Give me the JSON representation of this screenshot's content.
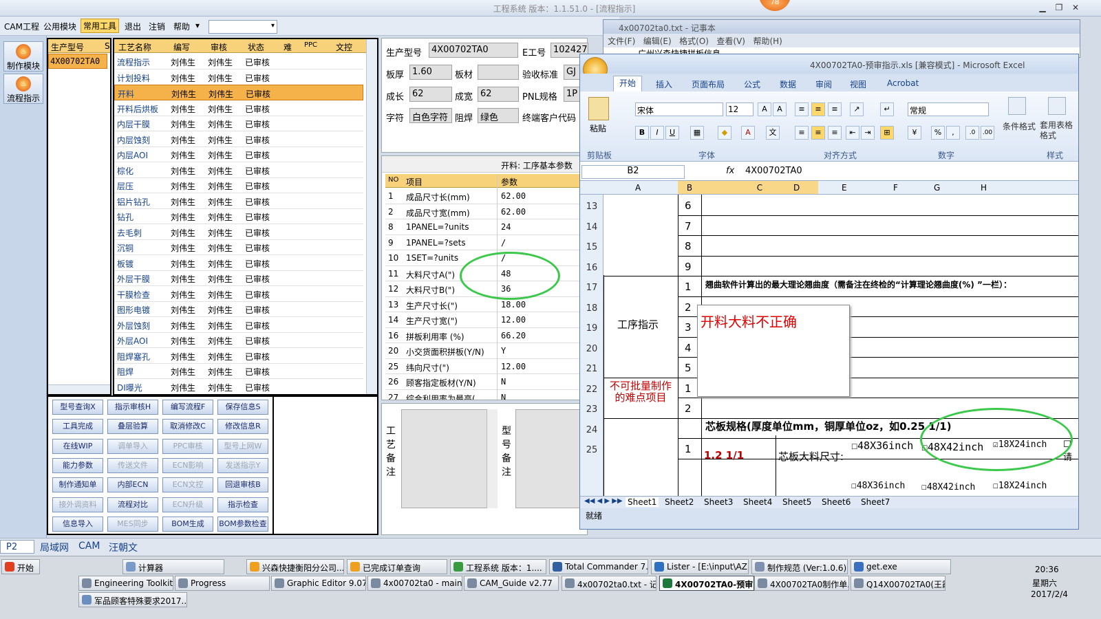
{
  "app": {
    "title": "工程系统  版本：1.1.51.0 - [流程指示]",
    "badge": "78",
    "win_min": "▁",
    "win_max": "❐",
    "win_close": "✕"
  },
  "menu": {
    "items": [
      "CAM工程",
      "公用模块",
      "常用工具",
      "退出",
      "注销",
      "帮助"
    ],
    "help_arrow": "▾",
    "combo_arrow": "▾"
  },
  "left_nav": {
    "make_module": "制作模块",
    "flow_indicator": "流程指示"
  },
  "model_list": {
    "header": "生产型号",
    "header2": "S",
    "item": "4X00702TA0"
  },
  "process_table": {
    "headers": [
      "工艺名称",
      "编写",
      "审核",
      "状态",
      "难",
      "PPC",
      "文控"
    ],
    "rows": [
      [
        "流程指示",
        "刘伟生",
        "刘伟生",
        "已审核"
      ],
      [
        "计划投料",
        "刘伟生",
        "刘伟生",
        "已审核"
      ],
      [
        "开料",
        "刘伟生",
        "刘伟生",
        "已审核"
      ],
      [
        "开料后烘板",
        "刘伟生",
        "刘伟生",
        "已审核"
      ],
      [
        "内层干膜",
        "刘伟生",
        "刘伟生",
        "已审核"
      ],
      [
        "内层蚀刻",
        "刘伟生",
        "刘伟生",
        "已审核"
      ],
      [
        "内层AOI",
        "刘伟生",
        "刘伟生",
        "已审核"
      ],
      [
        "棕化",
        "刘伟生",
        "刘伟生",
        "已审核"
      ],
      [
        "层压",
        "刘伟生",
        "刘伟生",
        "已审核"
      ],
      [
        "铝片钻孔",
        "刘伟生",
        "刘伟生",
        "已审核"
      ],
      [
        "钻孔",
        "刘伟生",
        "刘伟生",
        "已审核"
      ],
      [
        "去毛刺",
        "刘伟生",
        "刘伟生",
        "已审核"
      ],
      [
        "沉铜",
        "刘伟生",
        "刘伟生",
        "已审核"
      ],
      [
        "板镀",
        "刘伟生",
        "刘伟生",
        "已审核"
      ],
      [
        "外层干膜",
        "刘伟生",
        "刘伟生",
        "已审核"
      ],
      [
        "干膜检查",
        "刘伟生",
        "刘伟生",
        "已审核"
      ],
      [
        "图形电镀",
        "刘伟生",
        "刘伟生",
        "已审核"
      ],
      [
        "外层蚀刻",
        "刘伟生",
        "刘伟生",
        "已审核"
      ],
      [
        "外层AOI",
        "刘伟生",
        "刘伟生",
        "已审核"
      ],
      [
        "阻焊塞孔",
        "刘伟生",
        "刘伟生",
        "已审核"
      ],
      [
        "阻焊",
        "刘伟生",
        "刘伟生",
        "已审核"
      ],
      [
        "DI曝光",
        "刘伟生",
        "刘伟生",
        "已审核"
      ]
    ]
  },
  "buttons": [
    [
      "型号查询X",
      "指示审核H",
      "编写流程F",
      "保存信息S"
    ],
    [
      "工具完成",
      "叠层验算",
      "取消修改C",
      "修改信息R"
    ],
    [
      "在线WIP",
      "调单导入",
      "PPC审核",
      "型号上网W"
    ],
    [
      "能力参数",
      "传送文件",
      "ECN影响",
      "发送指示Y"
    ],
    [
      "制作通知单",
      "内部ECN",
      "ECN文控",
      "回退审核B"
    ],
    [
      "接外调资料",
      "流程对比",
      "ECN升级",
      "指示检查"
    ],
    [
      "信息导入",
      "MES同步",
      "BOM生成",
      "BOM参数检查"
    ]
  ],
  "info": {
    "model_label": "生产型号",
    "model_value": "4X00702TA0",
    "e_label": "E工号",
    "e_value": "102427",
    "thick_label": "板厚",
    "thick_value": "1.60",
    "mat_label": "板材",
    "mat_value": "",
    "accept_label": "验收标准",
    "accept_value": "GJ",
    "len_label": "成长",
    "len_value": "62",
    "wid_label": "成宽",
    "wid_value": "62",
    "pnl_label": "PNL规格",
    "pnl_value": "1P",
    "char_label": "字符",
    "char_value": "白色字符",
    "mask_label": "阻焊",
    "mask_value": "绿色",
    "cust_label": "终端客户代码"
  },
  "params": {
    "title": "开料: 工序基本参数",
    "headers": [
      "NO",
      "项目",
      "参数"
    ],
    "rows": [
      [
        "1",
        "成品尺寸长(mm)",
        "62.00"
      ],
      [
        "2",
        "成品尺寸宽(mm)",
        "62.00"
      ],
      [
        "8",
        "1PANEL=?units",
        "24"
      ],
      [
        "9",
        "1PANEL=?sets",
        "/"
      ],
      [
        "10",
        "1SET=?units",
        "/"
      ],
      [
        "11",
        "大料尺寸A(\")",
        "48"
      ],
      [
        "12",
        "大料尺寸B(\")",
        "36"
      ],
      [
        "13",
        "生产尺寸长(\")",
        "18.00"
      ],
      [
        "14",
        "生产尺寸宽(\")",
        "12.00"
      ],
      [
        "16",
        "拼板利用率 (%)",
        "66.20"
      ],
      [
        "20",
        "小交货面积拼板(Y/N)",
        "Y"
      ],
      [
        "25",
        "纬向尺寸(\")",
        "12.00"
      ],
      [
        "26",
        "顾客指定板材(Y/N)",
        "N"
      ],
      [
        "27",
        "综合利用率为最高(...",
        "N"
      ]
    ]
  },
  "remarks": {
    "process_remark": "工艺备注",
    "model_remark": "型号备注"
  },
  "notepad": {
    "title": "4x00702ta0.txt - 记事本",
    "menu": [
      "文件(F)",
      "编辑(E)",
      "格式(O)",
      "查看(V)",
      "帮助(H)"
    ],
    "first_line": "广州兴森快捷拼板信息"
  },
  "excel": {
    "title": "4X00702TA0-预审指示.xls  [兼容模式] - Microsoft Excel",
    "tabs": [
      "开始",
      "插入",
      "页面布局",
      "公式",
      "数据",
      "审阅",
      "视图",
      "Acrobat"
    ],
    "paste": "粘贴",
    "font_name": "宋体",
    "font_size": "12",
    "number_format": "常规",
    "cond_format": "条件格式",
    "table_format": "套用表格格式",
    "groups": [
      "剪贴板",
      "字体",
      "对齐方式",
      "数字",
      "样式"
    ],
    "name_box": "B2",
    "fx": "fx",
    "formula": "4X00702TA0",
    "cols": [
      "A",
      "B",
      "C",
      "D",
      "E",
      "F",
      "G",
      "H"
    ],
    "rows": [
      {
        "n": "13",
        "b": "6"
      },
      {
        "n": "14",
        "b": "7"
      },
      {
        "n": "15",
        "b": "8"
      },
      {
        "n": "16",
        "b": "9"
      },
      {
        "n": "17",
        "b": "1"
      },
      {
        "n": "18",
        "b": "2"
      },
      {
        "n": "19",
        "b": "3"
      },
      {
        "n": "20",
        "b": "4"
      },
      {
        "n": "21",
        "b": "5"
      },
      {
        "n": "22",
        "b": "1"
      },
      {
        "n": "23",
        "b": "2"
      },
      {
        "n": "24",
        "b": ""
      },
      {
        "n": "25",
        "b": "1"
      }
    ],
    "row17_text": "翘曲软件计算出的最大理论翘曲度（需备注在终检的“计算理论翘曲度(%) ”一栏）：",
    "process_instr": "工序指示",
    "hard_items": "不可批量制作的难点项目",
    "comment": "开料大料不正确",
    "core_spec": "芯板规格(厚度单位mm，铜厚单位oz，如0.25 1/1)",
    "core_val": "1.2 1/1",
    "core_size": "芯板大料尺寸:",
    "sizes": [
      "48X36inch",
      "48X42inch",
      "18X24inch",
      "请"
    ],
    "sheets": [
      "Sheet1",
      "Sheet2",
      "Sheet3",
      "Sheet4",
      "Sheet5",
      "Sheet6",
      "Sheet7"
    ],
    "status": "就绪"
  },
  "statusbar": {
    "p2": "P2",
    "items": [
      "局域网",
      "CAM",
      "汪朝文"
    ]
  },
  "taskbar": {
    "start": "开始",
    "row1": [
      "计算器",
      "兴森快捷衡阳分公司...",
      "已完成订单查询",
      "工程系统  版本：1....",
      "Total Commander 7.0 ...",
      "Lister - [E:\\input\\AZ7....",
      "制作规范 (Ver:1.0.6)",
      "get.exe"
    ],
    "row2": [
      "Engineering Toolkit 9....",
      "Progress",
      "Graphic Editor 9.07b...",
      "4x00702ta0 - main_qa",
      "CAM_Guide v2.77",
      "4x00702ta0.txt - 记...",
      "4X00702TA0-预审...",
      "4X00702TA0制作单....",
      "Q14X00702TA0(王霞..."
    ],
    "row3": [
      "军品顾客特殊要求2017...."
    ],
    "time": "20:36",
    "weekday": "星期六",
    "date": "2017/2/4"
  }
}
